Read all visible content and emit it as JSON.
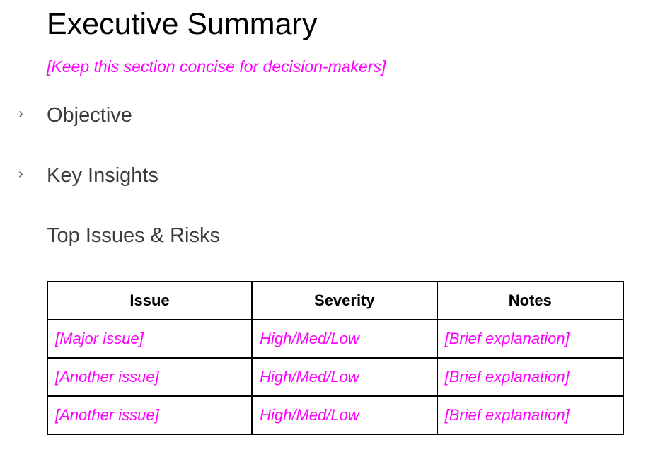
{
  "document": {
    "title": "Executive Summary",
    "hint": "[Keep this section concise for decision-makers]",
    "sections": [
      {
        "label": "Objective",
        "collapsible": true,
        "icon": "chevron-right-icon"
      },
      {
        "label": "Key Insights",
        "collapsible": true,
        "icon": "chevron-right-icon"
      },
      {
        "label": "Top Issues & Risks",
        "collapsible": false
      }
    ],
    "chevron_glyph": "›",
    "table": {
      "headers": [
        "Issue",
        "Severity",
        "Notes"
      ],
      "rows": [
        [
          "[Major issue]",
          "High/Med/Low",
          "[Brief explanation]"
        ],
        [
          "[Another issue]",
          "High/Med/Low",
          "[Brief explanation]"
        ],
        [
          "[Another issue]",
          "High/Med/Low",
          "[Brief explanation]"
        ]
      ]
    }
  }
}
